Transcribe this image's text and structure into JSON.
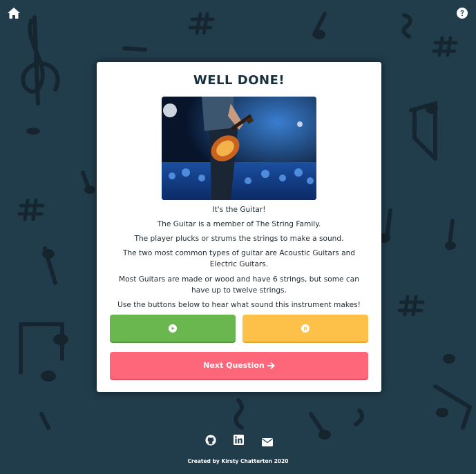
{
  "colors": {
    "background": "#213d4c",
    "card": "#ffffff",
    "play_button": "#6ab750",
    "pause_button": "#fdc048",
    "next_button": "#fe6679",
    "title": "#17303d"
  },
  "header": {
    "home_icon": "home-icon",
    "help_icon": "question-circle-icon"
  },
  "card": {
    "title": "WELL DONE!",
    "image_alt": "guitar-player-on-stage",
    "lines": [
      "It's the Guitar!",
      "The Guitar is a member of The String Family.",
      "The player plucks or strums the strings to make a sound.",
      "The two most common types of guitar are Acoustic Guitars and Electric Guitars.",
      "Most Guitars are made or wood and have 6 strings, but some can have up to twelve strings.",
      "Use the buttons below to hear what sound this instrument makes!"
    ],
    "play_icon": "play-circle-icon",
    "pause_icon": "pause-circle-icon",
    "next_label": "Next Question",
    "next_icon": "arrow-right-icon"
  },
  "footer": {
    "icons": [
      "github-icon",
      "linkedin-icon",
      "envelope-icon"
    ],
    "credit": "Created by Kirsty Chatterton 2020"
  }
}
